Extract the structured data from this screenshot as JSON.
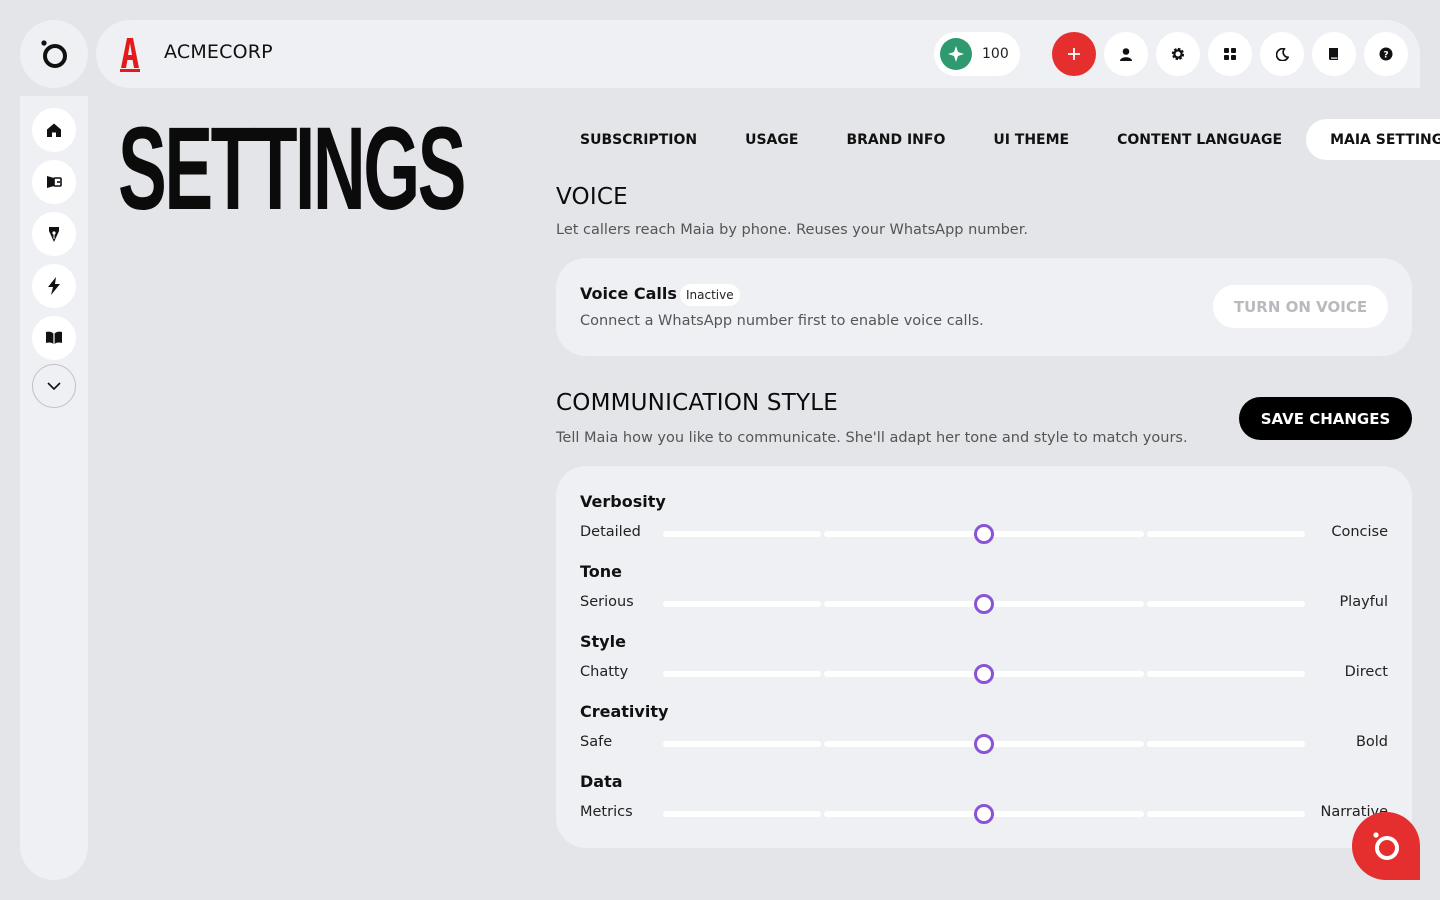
{
  "brand": {
    "name": "ACMECORP"
  },
  "credits": {
    "value": "100"
  },
  "page": {
    "title": "SETTINGS"
  },
  "tabs": [
    {
      "label": "SUBSCRIPTION"
    },
    {
      "label": "USAGE"
    },
    {
      "label": "BRAND INFO"
    },
    {
      "label": "UI THEME"
    },
    {
      "label": "CONTENT LANGUAGE"
    },
    {
      "label": "MAIA SETTINGS",
      "active": true
    }
  ],
  "voice": {
    "title": "VOICE",
    "description": "Let callers reach Maia by phone. Reuses your WhatsApp number.",
    "card_title": "Voice Calls",
    "status": "Inactive",
    "card_description": "Connect a WhatsApp number first to enable voice calls.",
    "button": "TURN ON VOICE"
  },
  "communication": {
    "title": "COMMUNICATION STYLE",
    "description": "Tell Maia how you like to communicate. She'll adapt her tone and style to match yours.",
    "save_button": "SAVE CHANGES",
    "sliders": [
      {
        "name": "Verbosity",
        "left": "Detailed",
        "right": "Concise",
        "value": 0.5
      },
      {
        "name": "Tone",
        "left": "Serious",
        "right": "Playful",
        "value": 0.5
      },
      {
        "name": "Style",
        "left": "Chatty",
        "right": "Direct",
        "value": 0.5
      },
      {
        "name": "Creativity",
        "left": "Safe",
        "right": "Bold",
        "value": 0.5
      },
      {
        "name": "Data",
        "left": "Metrics",
        "right": "Narrative",
        "value": 0.5
      }
    ]
  },
  "icons": {
    "app_logo": "maia-logo-icon",
    "credits": "sparkle-icon",
    "header": [
      "plus-icon",
      "user-icon",
      "gear-icon",
      "grid-icon",
      "moon-icon",
      "book-icon",
      "help-icon"
    ],
    "sidebar": [
      "home-icon",
      "megaphone-icon",
      "pen-nib-icon",
      "bolt-icon",
      "open-book-icon",
      "chevron-down-icon"
    ],
    "fab": "maia-chat-icon"
  },
  "colors": {
    "accent": "#e52e2e",
    "credits": "#2f9a6f",
    "slider_thumb": "#8a54d6",
    "save_button": "#000000"
  }
}
